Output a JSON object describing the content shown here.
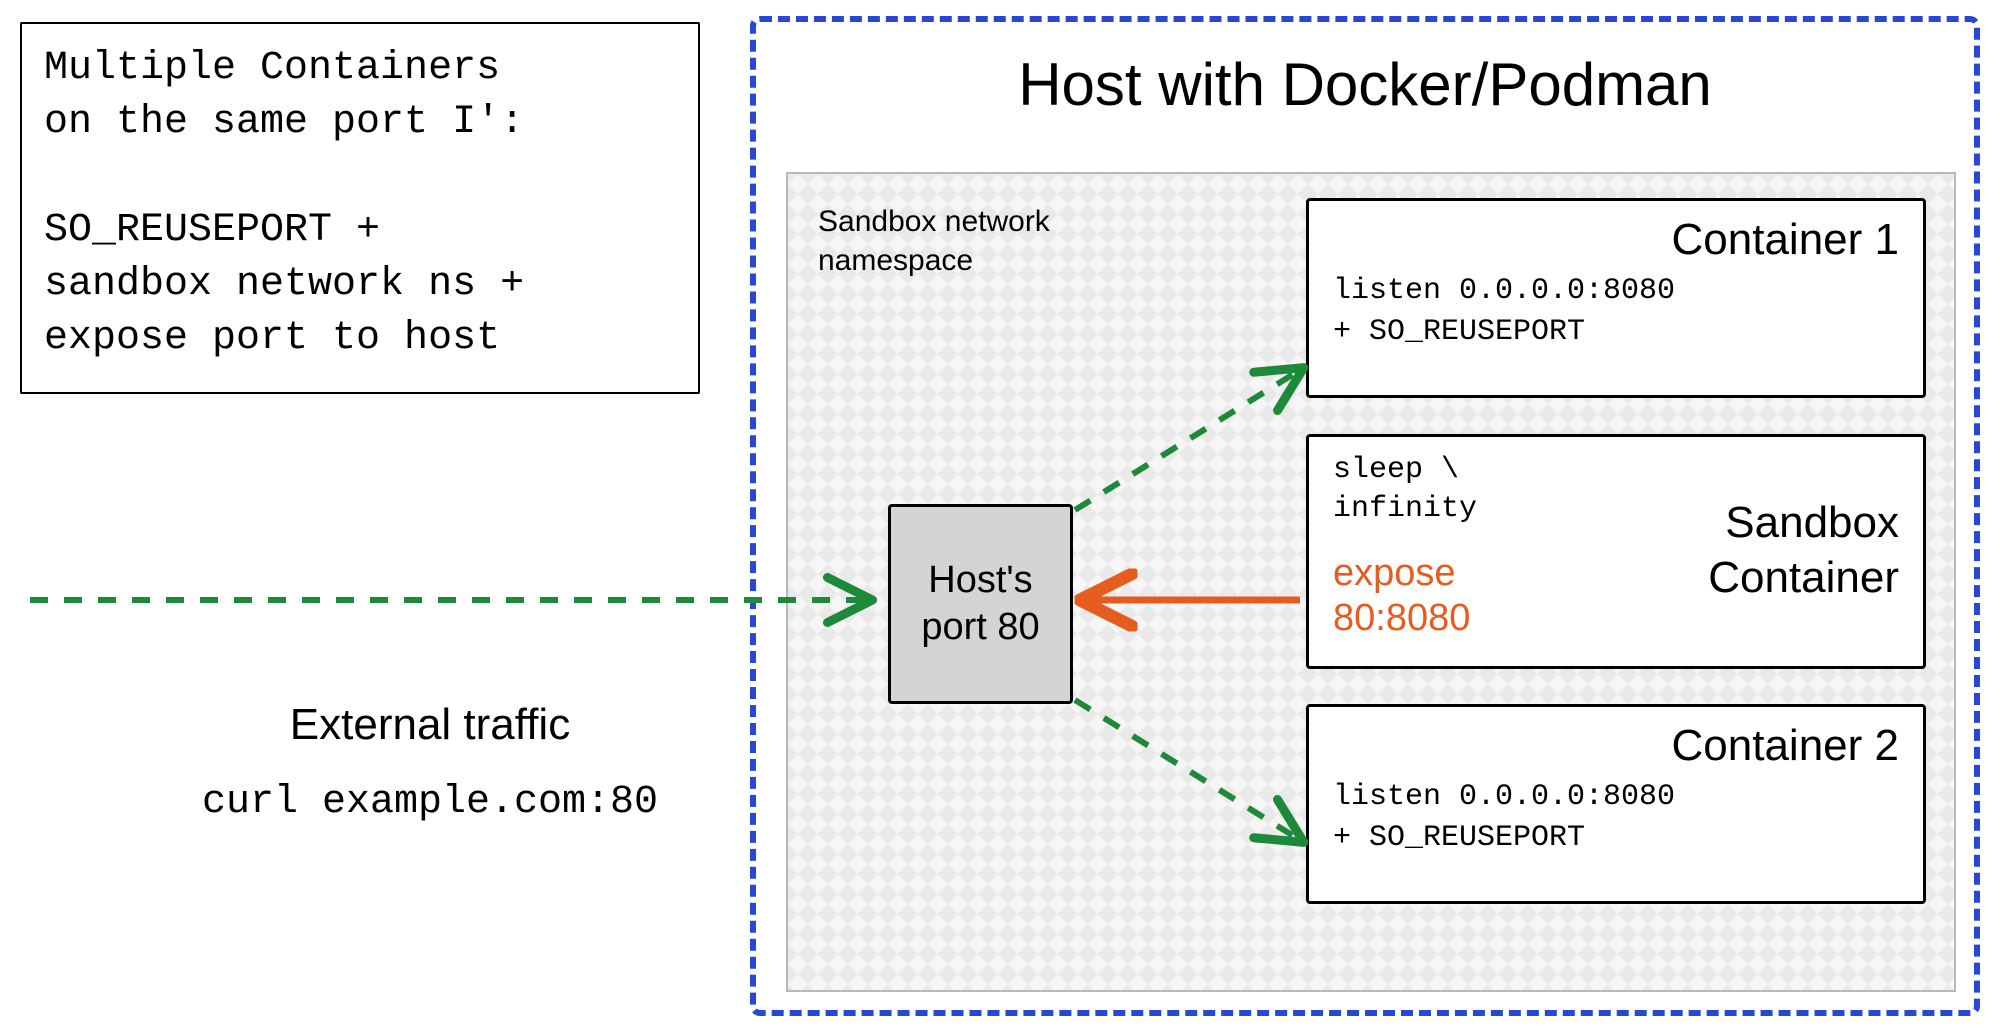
{
  "title_box": {
    "line1": "Multiple Containers",
    "line2": "on the same port I':",
    "line3": "SO_REUSEPORT +",
    "line4": "sandbox network ns +",
    "line5": "expose port to host"
  },
  "external": {
    "label": "External traffic",
    "command": "curl example.com:80"
  },
  "host": {
    "title": "Host with Docker/Podman"
  },
  "sandbox": {
    "label_line1": "Sandbox network",
    "label_line2": "namespace"
  },
  "port_box": {
    "line1": "Host's",
    "line2": "port 80"
  },
  "container1": {
    "title": "Container 1",
    "listen": "listen 0.0.0.0:8080",
    "opt": "+ SO_REUSEPORT"
  },
  "sandbox_container": {
    "title_line1": "Sandbox",
    "title_line2": "Container",
    "sleep_line1": "sleep \\",
    "sleep_line2": "infinity",
    "expose_line1": "expose",
    "expose_line2": "80:8080"
  },
  "container2": {
    "title": "Container 2",
    "listen": "listen 0.0.0.0:8080",
    "opt": "+ SO_REUSEPORT"
  },
  "colors": {
    "host_border": "#2847d6",
    "arrow_green": "#1d8a3a",
    "arrow_orange": "#e65c1f"
  }
}
